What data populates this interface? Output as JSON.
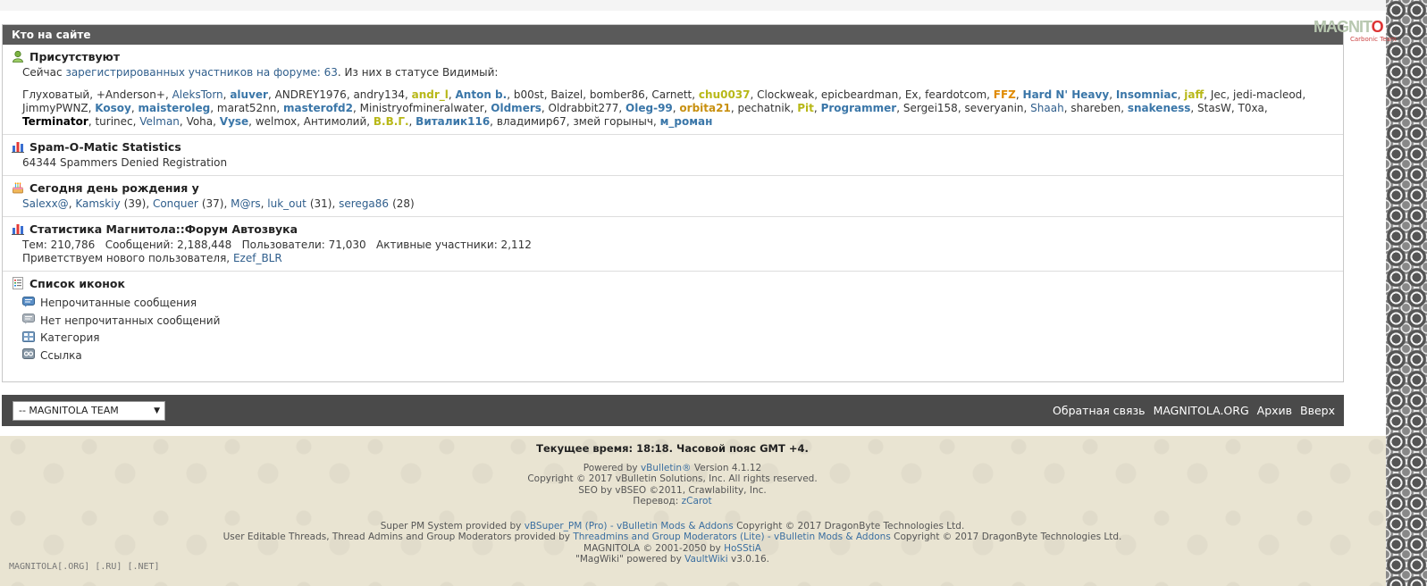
{
  "brand": {
    "logo_text_a": "MAGNIT",
    "logo_text_o": "O",
    "logo_sub": "Carbonic Team"
  },
  "wol": {
    "header": "Кто на сайте",
    "present": {
      "title": "Присутствуют",
      "summary_prefix": "Сейчас",
      "summary_link": "зарегистрированных участников на форуме: 63",
      "summary_suffix": ". Из них в статусе Видимый:",
      "users": [
        {
          "name": "Глуховатый",
          "style": "dark"
        },
        {
          "name": "+Anderson+",
          "style": "dark"
        },
        {
          "name": "AleksTorn",
          "style": "plain"
        },
        {
          "name": "aluver",
          "style": "bold"
        },
        {
          "name": "ANDREY1976",
          "style": "dark"
        },
        {
          "name": "andry134",
          "style": "dark"
        },
        {
          "name": "andr_l",
          "style": "yellow"
        },
        {
          "name": "Anton b.",
          "style": "bold"
        },
        {
          "name": "b00st",
          "style": "dark"
        },
        {
          "name": "Baizel",
          "style": "dark"
        },
        {
          "name": "bomber86",
          "style": "dark"
        },
        {
          "name": "Carnett",
          "style": "dark"
        },
        {
          "name": "chu0037",
          "style": "yellow"
        },
        {
          "name": "Clockweak",
          "style": "dark"
        },
        {
          "name": "epicbeardman",
          "style": "dark"
        },
        {
          "name": "Ex",
          "style": "dark"
        },
        {
          "name": "feardotcom",
          "style": "dark"
        },
        {
          "name": "FFZ",
          "style": "orange"
        },
        {
          "name": "Hard N' Heavy",
          "style": "bold"
        },
        {
          "name": "Insomniac",
          "style": "bold"
        },
        {
          "name": "jaff",
          "style": "yellow"
        },
        {
          "name": "Jec",
          "style": "dark"
        },
        {
          "name": "jedi-macleod",
          "style": "dark"
        },
        {
          "name": "JimmyPWNZ",
          "style": "dark"
        },
        {
          "name": "Kosoy",
          "style": "bold"
        },
        {
          "name": "maisteroleg",
          "style": "bold"
        },
        {
          "name": "marat52nn",
          "style": "dark"
        },
        {
          "name": "masterofd2",
          "style": "bold"
        },
        {
          "name": "Ministryofmineralwater",
          "style": "dark"
        },
        {
          "name": "Oldmers",
          "style": "bold"
        },
        {
          "name": "Oldrabbit277",
          "style": "dark"
        },
        {
          "name": "Oleg-99",
          "style": "bold"
        },
        {
          "name": "orbita21",
          "style": "gold"
        },
        {
          "name": "pechatnik",
          "style": "dark"
        },
        {
          "name": "Pit",
          "style": "yellow"
        },
        {
          "name": "Programmer",
          "style": "bold"
        },
        {
          "name": "Sergei158",
          "style": "dark"
        },
        {
          "name": "severyanin",
          "style": "dark"
        },
        {
          "name": "Shaah",
          "style": "plain"
        },
        {
          "name": "shareben",
          "style": "dark"
        },
        {
          "name": "snakeness",
          "style": "bold"
        },
        {
          "name": "StasW",
          "style": "dark"
        },
        {
          "name": "T0xa",
          "style": "dark"
        },
        {
          "name": "Terminator",
          "style": "black"
        },
        {
          "name": "turinec",
          "style": "dark"
        },
        {
          "name": "Velman",
          "style": "plain"
        },
        {
          "name": "Voha",
          "style": "dark"
        },
        {
          "name": "Vyse",
          "style": "bold"
        },
        {
          "name": "welmox",
          "style": "dark"
        },
        {
          "name": "Антимолий",
          "style": "dark"
        },
        {
          "name": "В.В.Г.",
          "style": "yellow"
        },
        {
          "name": "Виталик116",
          "style": "bold"
        },
        {
          "name": "владимир67",
          "style": "dark"
        },
        {
          "name": "змей горыныч",
          "style": "dark"
        },
        {
          "name": "м_роман",
          "style": "bold"
        }
      ]
    },
    "spam": {
      "title": "Spam-O-Matic Statistics",
      "text": "64344 Spammers Denied Registration"
    },
    "birthdays": {
      "title": "Сегодня день рождения у",
      "entries": [
        {
          "name": "Salexx@",
          "age": ""
        },
        {
          "name": "Kamskiy",
          "age": "(39)"
        },
        {
          "name": "Conquer",
          "age": "(37)"
        },
        {
          "name": "M@rs",
          "age": ""
        },
        {
          "name": "luk_out",
          "age": "(31)"
        },
        {
          "name": "serega86",
          "age": "(28)"
        }
      ]
    },
    "stats": {
      "title": "Статистика Магнитола::Форум Автозвука",
      "line1": "Тем: 210,786   Сообщений: 2,188,448   Пользователи: 71,030   Активные участники: 2,112",
      "welcome_prefix": "Приветствуем нового пользователя,",
      "welcome_user": "Ezef_BLR"
    },
    "icons": {
      "title": "Список иконок",
      "items": [
        {
          "label": "Непрочитанные сообщения",
          "icon": "unread-messages-icon"
        },
        {
          "label": "Нет непрочитанных сообщений",
          "icon": "no-unread-messages-icon"
        },
        {
          "label": "Категория",
          "icon": "category-icon"
        },
        {
          "label": "Ссылка",
          "icon": "link-icon"
        }
      ]
    }
  },
  "footer": {
    "style_select_value": "-- MAGNITOLA TEAM",
    "links": [
      "Обратная связь",
      "MAGNITOLA.ORG",
      "Архив",
      "Вверх"
    ]
  },
  "copyright": {
    "time": "Текущее время: 18:18. Часовой пояс GMT +4.",
    "powered_prefix": "Powered by ",
    "powered_link": "vBulletin®",
    "powered_suffix": " Version 4.1.12",
    "line2": "Copyright © 2017 vBulletin Solutions, Inc. All rights reserved.",
    "line3": "SEO by vBSEO ©2011, Crawlability, Inc.",
    "translation_prefix": "Перевод: ",
    "translation_link": "zCarot",
    "spm_prefix": "Super PM System provided by ",
    "spm_link": "vBSuper_PM (Pro) - vBulletin Mods & Addons",
    "spm_suffix": " Copyright © 2017 DragonByte Technologies Ltd.",
    "threads_prefix": "User Editable Threads, Thread Admins and Group Moderators provided by ",
    "threads_link": "Threadmins and Group Moderators (Lite) - vBulletin Mods & Addons",
    "threads_suffix": " Copyright © 2017 DragonByte Technologies Ltd.",
    "mag_prefix": "MAGNITOLA © 2001-2050 by ",
    "mag_link": "HoSStiA",
    "wiki_prefix": "\"MagWiki\" powered by ",
    "wiki_link": "VaultWiki",
    "wiki_suffix": " v3.0.16."
  },
  "bottom_mark": "MAGNITOLA[.ORG] [.RU] [.NET]",
  "colors": {
    "header_bg": "#5a5a5a",
    "footer_bar_bg": "#4a4a4a",
    "link": "#2f5e8c",
    "bold_user": "#3a76a8",
    "yellow_user": "#b8b818",
    "orange_user": "#e08a00"
  }
}
